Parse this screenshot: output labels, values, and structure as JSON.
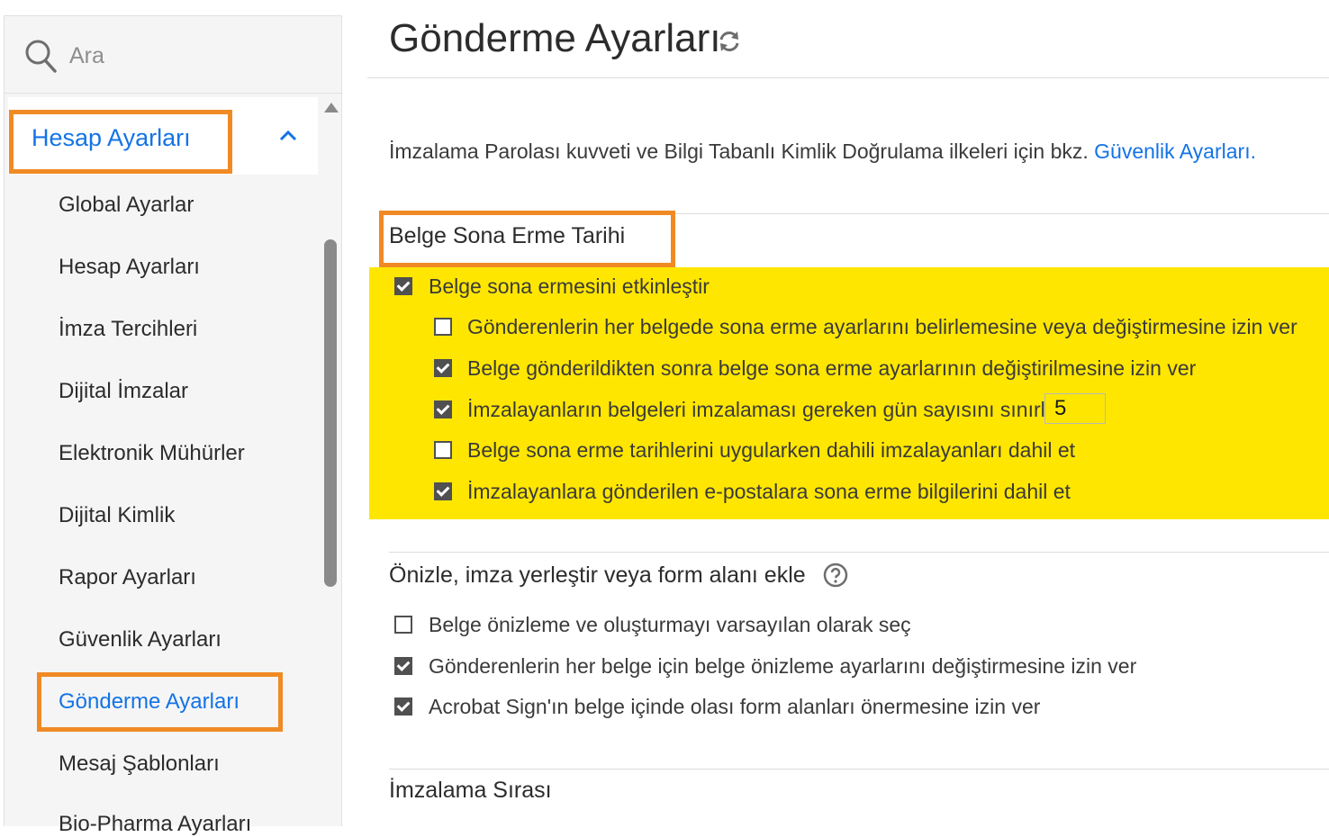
{
  "search": {
    "placeholder": "Ara",
    "icon": "search-icon"
  },
  "sidebar": {
    "header": "Hesap Ayarları",
    "items": [
      {
        "label": "Global Ayarlar",
        "active": false
      },
      {
        "label": "Hesap Ayarları",
        "active": false
      },
      {
        "label": "İmza Tercihleri",
        "active": false
      },
      {
        "label": "Dijital İmzalar",
        "active": false
      },
      {
        "label": "Elektronik Mühürler",
        "active": false
      },
      {
        "label": "Dijital Kimlik",
        "active": false
      },
      {
        "label": "Rapor Ayarları",
        "active": false
      },
      {
        "label": "Güvenlik Ayarları",
        "active": false
      },
      {
        "label": "Gönderme Ayarları",
        "active": true
      },
      {
        "label": "Mesaj Şablonları",
        "active": false
      },
      {
        "label": "Bio-Pharma Ayarları",
        "active": false
      }
    ]
  },
  "page": {
    "title": "Gönderme Ayarları"
  },
  "info": {
    "text": "İmzalama Parolası kuvveti ve Bilgi Tabanlı Kimlik Doğrulama ilkeleri için bkz. ",
    "link": "Güvenlik Ayarları",
    "suffix": "."
  },
  "expiration": {
    "title": "Belge Sona Erme Tarihi",
    "enable": {
      "label": "Belge sona ermesini etkinleştir",
      "checked": true
    },
    "options": [
      {
        "label": "Gönderenlerin her belgede sona erme ayarlarını belirlemesine veya değiştirmesine izin ver",
        "checked": false
      },
      {
        "label": "Belge gönderildikten sonra belge sona erme ayarlarının değiştirilmesine izin ver",
        "checked": true
      },
      {
        "label": "İmzalayanların belgeleri imzalaması gereken gün sayısını sınırla:",
        "checked": true
      },
      {
        "label": "Belge sona erme tarihlerini uygularken dahili imzalayanları dahil et",
        "checked": false
      },
      {
        "label": "İmzalayanlara gönderilen e-postalara sona erme bilgilerini dahil et",
        "checked": true
      }
    ],
    "days_value": "5"
  },
  "preview": {
    "title": "Önizle, imza yerleştir veya form alanı ekle",
    "options": [
      {
        "label": "Belge önizleme ve oluşturmayı varsayılan olarak seç",
        "checked": false
      },
      {
        "label": "Gönderenlerin her belge için belge önizleme ayarlarını değiştirmesine izin ver",
        "checked": true
      },
      {
        "label": "Acrobat Sign'ın belge içinde olası form alanları önermesine izin ver",
        "checked": true
      }
    ]
  },
  "signing_order": {
    "title": "İmzalama Sırası"
  },
  "colors": {
    "accent": "#1473e6",
    "highlight": "#ffe600",
    "annotation": "#f08a24"
  }
}
